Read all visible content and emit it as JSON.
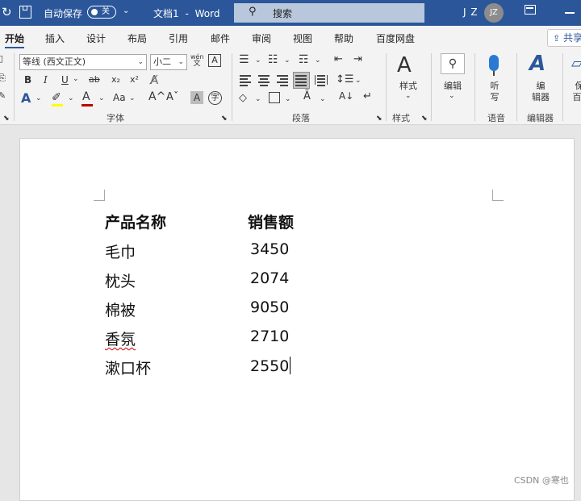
{
  "titlebar": {
    "autosave_label": "自动保存",
    "autosave_state": "关",
    "doc_title": "文档1",
    "separator": "-",
    "app_name": "Word",
    "search_placeholder": "搜索",
    "user_initials": "J Z",
    "avatar_initials": "JZ"
  },
  "tabs": [
    "开始",
    "插入",
    "设计",
    "布局",
    "引用",
    "邮件",
    "审阅",
    "视图",
    "帮助",
    "百度网盘"
  ],
  "share_label": "共享",
  "ribbon": {
    "font_name": "等线 (西文正文)",
    "font_size": "小二",
    "phonetic_top": "wén",
    "phonetic_bottom": "文",
    "bold": "B",
    "italic": "I",
    "underline": "U",
    "strike": "ab",
    "subscript": "x₂",
    "superscript": "x²",
    "grow_font": "A^",
    "shrink_font": "Aˇ",
    "change_case": "Aa",
    "group_font": "字体",
    "group_paragraph": "段落",
    "group_styles": "样式",
    "styles_label": "样式",
    "edit_label": "编辑",
    "dictate_label_1": "听",
    "dictate_label_2": "写",
    "group_voice": "语音",
    "editor_label_1": "编",
    "editor_label_2": "辑器",
    "group_editor": "编辑器",
    "cut_label_1": "保",
    "cut_label_2": "百"
  },
  "colors": {
    "titlebar": "#2b579a",
    "highlight": "#ffff00",
    "font_color": "#c00000",
    "text_effect": "#2b579a"
  },
  "document": {
    "headers": [
      "产品名称",
      "销售额"
    ],
    "rows": [
      [
        "毛巾",
        "3450"
      ],
      [
        "枕头",
        "2074"
      ],
      [
        "棉被",
        "9050"
      ],
      [
        "香氛",
        "2710"
      ],
      [
        "漱口杯",
        "2550"
      ]
    ]
  },
  "watermark": "CSDN @寒也"
}
